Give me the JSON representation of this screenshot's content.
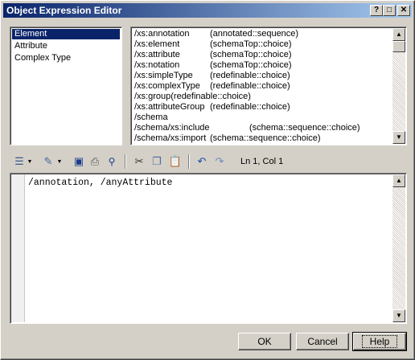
{
  "window": {
    "title": "Object Expression Editor",
    "controls": {
      "help": "?",
      "restore": "□",
      "close": "✕"
    }
  },
  "categories": [
    {
      "label": "Element",
      "selected": true
    },
    {
      "label": "Attribute",
      "selected": false
    },
    {
      "label": "Complex Type",
      "selected": false
    }
  ],
  "items": [
    {
      "name": "/xs:annotation",
      "desc": "(annotated::sequence)"
    },
    {
      "name": "/xs:element",
      "desc": "(schemaTop::choice)"
    },
    {
      "name": "/xs:attribute",
      "desc": "(schemaTop::choice)"
    },
    {
      "name": "/xs:notation",
      "desc": "(schemaTop::choice)"
    },
    {
      "name": "/xs:simpleType",
      "desc": "(redefinable::choice)"
    },
    {
      "name": "/xs:complexType",
      "desc": "(redefinable::choice)"
    },
    {
      "name": "/xs:group(redefinable::choice)",
      "desc": ""
    },
    {
      "name": "/xs:attributeGroup",
      "desc": "(redefinable::choice)"
    },
    {
      "name": "/schema",
      "desc": ""
    },
    {
      "name": "/schema/xs:include",
      "desc": "(schema::sequence::choice)"
    },
    {
      "name": "/schema/xs:import",
      "desc": "(schema::sequence::choice)"
    }
  ],
  "toolbar": {
    "position_label": "Ln 1, Col 1",
    "icons": [
      "properties-icon",
      "edit-icon",
      "save-icon",
      "print-icon",
      "find-icon",
      "cut-icon",
      "copy-icon",
      "paste-icon",
      "undo-icon",
      "redo-icon"
    ]
  },
  "editor": {
    "content": "/annotation, /anyAttribute"
  },
  "buttons": {
    "ok": "OK",
    "cancel": "Cancel",
    "help": "Help"
  },
  "colors": {
    "titlebar_start": "#0a246a",
    "titlebar_end": "#a6caf0",
    "selection": "#0a246a",
    "face": "#d4d0c8"
  }
}
